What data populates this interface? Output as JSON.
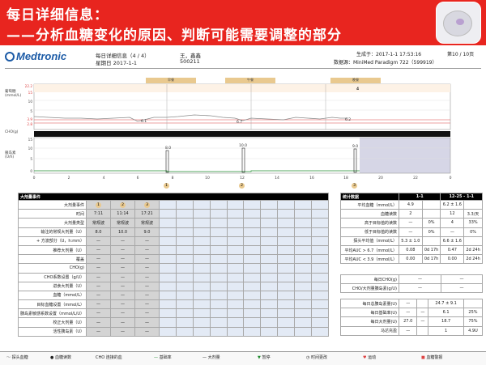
{
  "banner": {
    "title_line1": "每日详细信息：",
    "title_line2": "——分析血糖变化的原因、判断可能需要调整的部分"
  },
  "brand": {
    "name": "Medtronic"
  },
  "header": {
    "report_title": "每日详细信息（4 / 4）",
    "weekday_date": "星期日 2017-1-1",
    "patient_name": "王，鑫鑫",
    "patient_id": "500211",
    "generated": "生成于：2017-1-1  17:53:16",
    "page": "第10 / 10页",
    "device": "数据源：MiniMed Paradigm 722（599919）"
  },
  "meal_tabs": [
    "早餐",
    "午餐",
    "晚餐"
  ],
  "glucose_chart": {
    "ylabel": "葡萄糖\n(mmol/L)",
    "y_ticks": [
      "22.2",
      "15",
      "10",
      "5",
      "3.9",
      "2.8"
    ],
    "marks": [
      "6.1",
      "6.7",
      "6.2",
      "4"
    ],
    "cho_label": "CHO(g)"
  },
  "insulin_chart": {
    "ylabel": "胰岛素\n(U/h)",
    "y_ticks": [
      "15",
      "10",
      "5",
      "0"
    ],
    "bolus_labels": [
      "8.0",
      "10.0",
      "9.0"
    ],
    "x_ticks": [
      "0",
      "2",
      "4",
      "6",
      "8",
      "10",
      "12",
      "14",
      "16",
      "18",
      "20",
      "22",
      "0"
    ]
  },
  "timeline_markers": [
    "1",
    "2",
    "3"
  ],
  "bolus_table": {
    "header": "大剂量事件",
    "rows": [
      {
        "label": "大剂量事件",
        "values": [
          "1",
          "2",
          "3"
        ],
        "circle": true
      },
      {
        "label": "时间",
        "values": [
          "7:11",
          "11:14",
          "17:21"
        ]
      },
      {
        "label": "大剂量类型",
        "values": [
          "常规波",
          "常规波",
          "常规波"
        ]
      },
      {
        "label": "输注的常规大剂量（U）",
        "values": [
          "8.0",
          "10.0",
          "9.0"
        ]
      },
      {
        "label": "+ 方波部分（U，h:mm）",
        "values": [
          "—",
          "—",
          "—"
        ]
      },
      {
        "label": "推荐大剂量（U）",
        "values": [
          "—",
          "—",
          "—"
        ]
      },
      {
        "label": "覆盖",
        "values": [
          "—",
          "—",
          "—"
        ]
      },
      {
        "label": "CHO(g)",
        "values": [
          "—",
          "—",
          "—"
        ]
      },
      {
        "label": "CHO系数设置（g/U）",
        "values": [
          "—",
          "—",
          "—"
        ]
      },
      {
        "label": "进食大剂量（U）",
        "values": [
          "—",
          "—",
          "—"
        ]
      },
      {
        "label": "血糖（mmol/L）",
        "values": [
          "—",
          "—",
          "—"
        ]
      },
      {
        "label": "目标血糖设置（mmol/L）",
        "values": [
          "—",
          "—",
          "—"
        ]
      },
      {
        "label": "胰岛素敏感系数设置（mmol/L/U）",
        "values": [
          "—",
          "—",
          "—"
        ]
      },
      {
        "label": "校正大剂量（U）",
        "values": [
          "—",
          "—",
          "—"
        ]
      },
      {
        "label": "活性胰岛素（U）",
        "values": [
          "—",
          "—",
          "—"
        ]
      }
    ]
  },
  "stats": {
    "header": [
      "统计数据",
      "1-1",
      "12-25 - 1-1"
    ],
    "group1": [
      [
        "平均血糖（mmol/L）",
        "4.9",
        "",
        "6.2 ± 1.6",
        ""
      ],
      [
        "血糖读数",
        "2",
        "",
        "12",
        "3.3/天"
      ],
      [
        "高于目标值的读数",
        "—",
        "0%",
        "4",
        "33%"
      ],
      [
        "低于目标值的读数",
        "—",
        "0%",
        "—",
        "0%"
      ],
      [
        "探头平均值（mmol/L）",
        "5.3 ± 1.0",
        "",
        "6.6 ± 1.6",
        ""
      ],
      [
        "平均AUC > 6.7（mmol/L）",
        "0.08",
        "0d 17h",
        "0.47",
        "2d 24h"
      ],
      [
        "平均AUC < 3.9（mmol/L）",
        "0.00",
        "0d 17h",
        "0.00",
        "2d 24h"
      ]
    ],
    "group2": [
      [
        "每日CHO(g)",
        "—",
        "—"
      ],
      [
        "CHO/大剂量胰岛素(g/U)",
        "—",
        "—"
      ]
    ],
    "group3": [
      [
        "每日总胰岛素量(U)",
        "—",
        "",
        "24.7 ± 9.1",
        ""
      ],
      [
        "每日基础率(U)",
        "—",
        "—",
        "6.1",
        "25%"
      ],
      [
        "每日大剂量(U)",
        "27.0",
        "—",
        "18.7",
        "75%"
      ],
      [
        "马达充盈",
        "—",
        "",
        "1",
        "4.9U"
      ]
    ]
  },
  "legend": [
    "探头血糖",
    "血糖读数",
    "CHO 连接的血",
    "基础率",
    "大剂量",
    "暂停",
    "时间更改",
    "运动",
    "血糖警报"
  ],
  "colors": {
    "banner": "#e8251f",
    "tab": "#e9c98f",
    "line": "#8a8a8a",
    "basal": "#1d8a2c",
    "bolus": "#222222"
  }
}
